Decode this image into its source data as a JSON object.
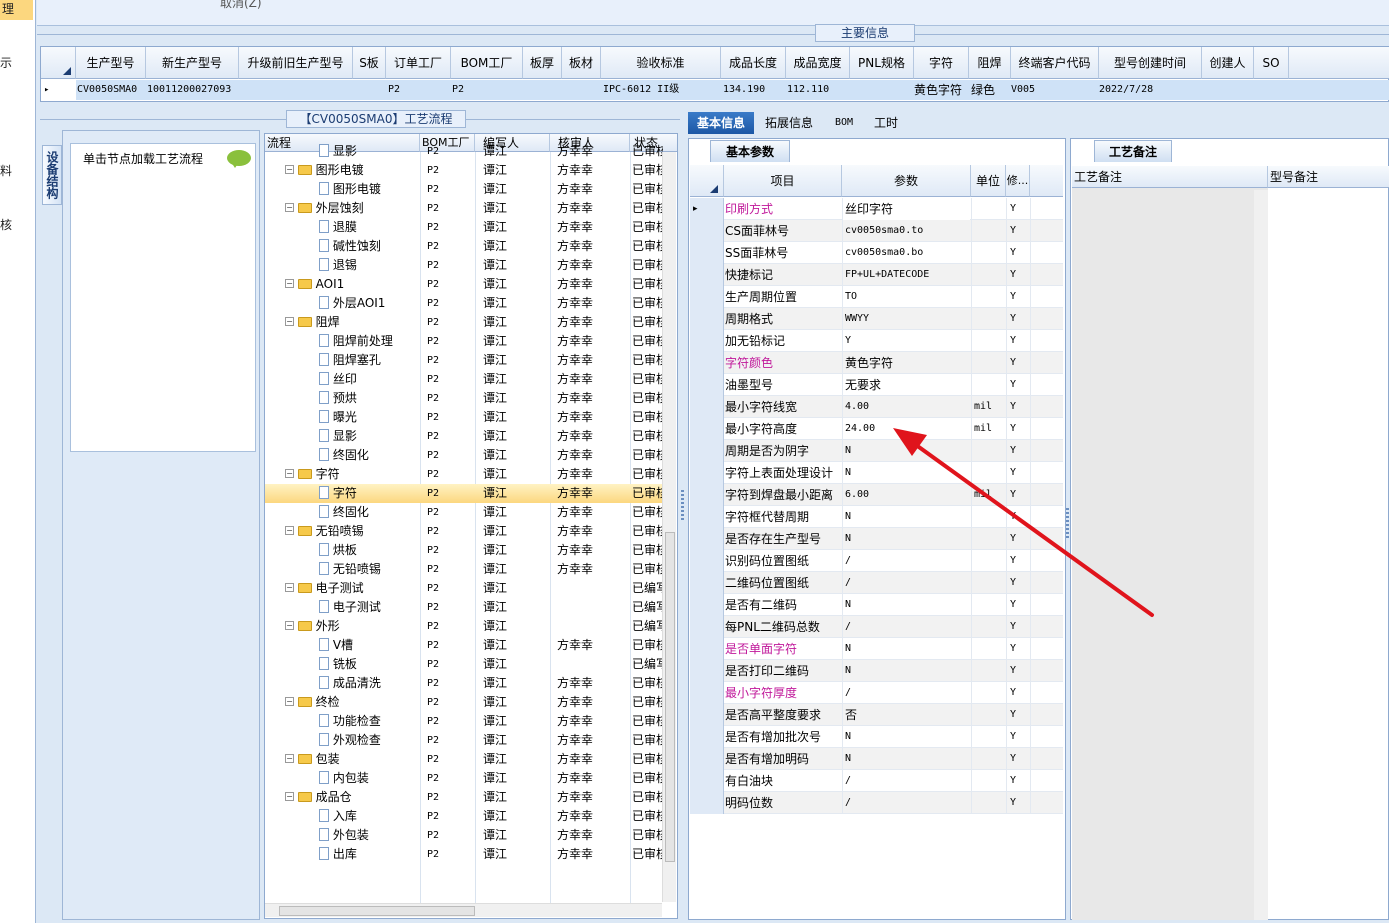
{
  "left_nav": {
    "items": [
      "理",
      "示",
      "料",
      "核"
    ]
  },
  "top": {
    "cut_label": "取消(Z)"
  },
  "main_info": {
    "title": "主要信息",
    "columns": [
      "生产型号",
      "新生产型号",
      "升级前旧生产型号",
      "S板",
      "订单工厂",
      "BOM工厂",
      "板厚",
      "板材",
      "验收标准",
      "成品长度",
      "成品宽度",
      "PNL规格",
      "字符",
      "阻焊",
      "终端客户代码",
      "型号创建时间",
      "创建人",
      "SO"
    ],
    "row": {
      "marker": "▸",
      "production_model": "CV0050SMA0",
      "new_model": "10011200027093",
      "order_factory": "P2",
      "bom_factory": "P2",
      "acceptance": "IPC-6012 II级",
      "length": "134.190",
      "width": "112.110",
      "character": "黄色字符",
      "solder_mask": "绿色",
      "customer_code": "V005",
      "created": "2022/7/28"
    }
  },
  "process_panel": {
    "title": "【CV0050SMA0】工艺流程",
    "vertical_tab": "设备结构",
    "load_hint": "单击节点加载工艺流程",
    "columns": [
      "流程",
      "BOM工厂",
      "编写人",
      "核审人",
      "状态"
    ],
    "rows": [
      {
        "name": "显影",
        "level": 2,
        "type": "doc",
        "bom": "P2",
        "writer": "谭江",
        "reviewer": "方幸幸",
        "status": "已审核"
      },
      {
        "name": "图形电镀",
        "level": 1,
        "type": "folder",
        "bom": "P2",
        "writer": "谭江",
        "reviewer": "方幸幸",
        "status": "已审核"
      },
      {
        "name": "图形电镀",
        "level": 2,
        "type": "doc",
        "bom": "P2",
        "writer": "谭江",
        "reviewer": "方幸幸",
        "status": "已审核"
      },
      {
        "name": "外层蚀刻",
        "level": 1,
        "type": "folder",
        "bom": "P2",
        "writer": "谭江",
        "reviewer": "方幸幸",
        "status": "已审核"
      },
      {
        "name": "退膜",
        "level": 2,
        "type": "doc",
        "bom": "P2",
        "writer": "谭江",
        "reviewer": "方幸幸",
        "status": "已审核"
      },
      {
        "name": "碱性蚀刻",
        "level": 2,
        "type": "doc",
        "bom": "P2",
        "writer": "谭江",
        "reviewer": "方幸幸",
        "status": "已审核"
      },
      {
        "name": "退锡",
        "level": 2,
        "type": "doc",
        "bom": "P2",
        "writer": "谭江",
        "reviewer": "方幸幸",
        "status": "已审核"
      },
      {
        "name": "AOI1",
        "level": 1,
        "type": "folder",
        "bom": "P2",
        "writer": "谭江",
        "reviewer": "方幸幸",
        "status": "已审核"
      },
      {
        "name": "外层AOI1",
        "level": 2,
        "type": "doc",
        "bom": "P2",
        "writer": "谭江",
        "reviewer": "方幸幸",
        "status": "已审核"
      },
      {
        "name": "阻焊",
        "level": 1,
        "type": "folder",
        "bom": "P2",
        "writer": "谭江",
        "reviewer": "方幸幸",
        "status": "已审核"
      },
      {
        "name": "阻焊前处理",
        "level": 2,
        "type": "doc",
        "bom": "P2",
        "writer": "谭江",
        "reviewer": "方幸幸",
        "status": "已审核"
      },
      {
        "name": "阻焊塞孔",
        "level": 2,
        "type": "doc",
        "bom": "P2",
        "writer": "谭江",
        "reviewer": "方幸幸",
        "status": "已审核"
      },
      {
        "name": "丝印",
        "level": 2,
        "type": "doc",
        "bom": "P2",
        "writer": "谭江",
        "reviewer": "方幸幸",
        "status": "已审核"
      },
      {
        "name": "预烘",
        "level": 2,
        "type": "doc",
        "bom": "P2",
        "writer": "谭江",
        "reviewer": "方幸幸",
        "status": "已审核"
      },
      {
        "name": "曝光",
        "level": 2,
        "type": "doc",
        "bom": "P2",
        "writer": "谭江",
        "reviewer": "方幸幸",
        "status": "已审核"
      },
      {
        "name": "显影",
        "level": 2,
        "type": "doc",
        "bom": "P2",
        "writer": "谭江",
        "reviewer": "方幸幸",
        "status": "已审核"
      },
      {
        "name": "终固化",
        "level": 2,
        "type": "doc",
        "bom": "P2",
        "writer": "谭江",
        "reviewer": "方幸幸",
        "status": "已审核"
      },
      {
        "name": "字符",
        "level": 1,
        "type": "folder",
        "bom": "P2",
        "writer": "谭江",
        "reviewer": "方幸幸",
        "status": "已审核"
      },
      {
        "name": "字符",
        "level": 2,
        "type": "doc",
        "bom": "P2",
        "writer": "谭江",
        "reviewer": "方幸幸",
        "status": "已审核",
        "selected": true
      },
      {
        "name": "终固化",
        "level": 2,
        "type": "doc",
        "bom": "P2",
        "writer": "谭江",
        "reviewer": "方幸幸",
        "status": "已审核"
      },
      {
        "name": "无铅喷锡",
        "level": 1,
        "type": "folder",
        "bom": "P2",
        "writer": "谭江",
        "reviewer": "方幸幸",
        "status": "已审核"
      },
      {
        "name": "烘板",
        "level": 2,
        "type": "doc",
        "bom": "P2",
        "writer": "谭江",
        "reviewer": "方幸幸",
        "status": "已审核"
      },
      {
        "name": "无铅喷锡",
        "level": 2,
        "type": "doc",
        "bom": "P2",
        "writer": "谭江",
        "reviewer": "方幸幸",
        "status": "已审核"
      },
      {
        "name": "电子测试",
        "level": 1,
        "type": "folder",
        "bom": "P2",
        "writer": "谭江",
        "reviewer": "",
        "status": "已编写"
      },
      {
        "name": "电子测试",
        "level": 2,
        "type": "doc",
        "bom": "P2",
        "writer": "谭江",
        "reviewer": "",
        "status": "已编写"
      },
      {
        "name": "外形",
        "level": 1,
        "type": "folder",
        "bom": "P2",
        "writer": "谭江",
        "reviewer": "",
        "status": "已编写"
      },
      {
        "name": "V槽",
        "level": 2,
        "type": "doc",
        "bom": "P2",
        "writer": "谭江",
        "reviewer": "方幸幸",
        "status": "已审核"
      },
      {
        "name": "铣板",
        "level": 2,
        "type": "doc",
        "bom": "P2",
        "writer": "谭江",
        "reviewer": "",
        "status": "已编写"
      },
      {
        "name": "成品清洗",
        "level": 2,
        "type": "doc",
        "bom": "P2",
        "writer": "谭江",
        "reviewer": "方幸幸",
        "status": "已审核"
      },
      {
        "name": "终检",
        "level": 1,
        "type": "folder",
        "bom": "P2",
        "writer": "谭江",
        "reviewer": "方幸幸",
        "status": "已审核"
      },
      {
        "name": "功能检查",
        "level": 2,
        "type": "doc",
        "bom": "P2",
        "writer": "谭江",
        "reviewer": "方幸幸",
        "status": "已审核"
      },
      {
        "name": "外观检查",
        "level": 2,
        "type": "doc",
        "bom": "P2",
        "writer": "谭江",
        "reviewer": "方幸幸",
        "status": "已审核"
      },
      {
        "name": "包装",
        "level": 1,
        "type": "folder",
        "bom": "P2",
        "writer": "谭江",
        "reviewer": "方幸幸",
        "status": "已审核"
      },
      {
        "name": "内包装",
        "level": 2,
        "type": "doc",
        "bom": "P2",
        "writer": "谭江",
        "reviewer": "方幸幸",
        "status": "已审核"
      },
      {
        "name": "成品仓",
        "level": 1,
        "type": "folder",
        "bom": "P2",
        "writer": "谭江",
        "reviewer": "方幸幸",
        "status": "已审核"
      },
      {
        "name": "入库",
        "level": 2,
        "type": "doc",
        "bom": "P2",
        "writer": "谭江",
        "reviewer": "方幸幸",
        "status": "已审核"
      },
      {
        "name": "外包装",
        "level": 2,
        "type": "doc",
        "bom": "P2",
        "writer": "谭江",
        "reviewer": "方幸幸",
        "status": "已审核"
      },
      {
        "name": "出库",
        "level": 2,
        "type": "doc",
        "bom": "P2",
        "writer": "谭江",
        "reviewer": "方幸幸",
        "status": "已审核"
      }
    ]
  },
  "right_tabs": [
    "基本信息",
    "拓展信息",
    "BOM",
    "工时"
  ],
  "basic_params": {
    "section_title": "基本参数",
    "columns": [
      "项目",
      "参数",
      "单位",
      "修..."
    ],
    "rows": [
      {
        "item": "印刷方式",
        "value": "丝印字符",
        "unit": "",
        "mod": "Y",
        "highlight": true,
        "current": true
      },
      {
        "item": "CS面菲林号",
        "value": "cv0050sma0.to",
        "unit": "",
        "mod": "Y"
      },
      {
        "item": "SS面菲林号",
        "value": "cv0050sma0.bo",
        "unit": "",
        "mod": "Y"
      },
      {
        "item": "快捷标记",
        "value": "FP+UL+DATECODE",
        "unit": "",
        "mod": "Y"
      },
      {
        "item": "生产周期位置",
        "value": "TO",
        "unit": "",
        "mod": "Y"
      },
      {
        "item": "周期格式",
        "value": "WWYY",
        "unit": "",
        "mod": "Y"
      },
      {
        "item": "加无铅标记",
        "value": "Y",
        "unit": "",
        "mod": "Y"
      },
      {
        "item": "字符颜色",
        "value": "黄色字符",
        "unit": "",
        "mod": "Y",
        "highlight": true
      },
      {
        "item": "油墨型号",
        "value": "无要求",
        "unit": "",
        "mod": "Y"
      },
      {
        "item": "最小字符线宽",
        "value": "4.00",
        "unit": "mil",
        "mod": "Y"
      },
      {
        "item": "最小字符高度",
        "value": "24.00",
        "unit": "mil",
        "mod": "Y"
      },
      {
        "item": "周期是否为阴字",
        "value": "N",
        "unit": "",
        "mod": "Y"
      },
      {
        "item": "字符上表面处理设计",
        "value": "N",
        "unit": "",
        "mod": "Y"
      },
      {
        "item": "字符到焊盘最小距离",
        "value": "6.00",
        "unit": "mil",
        "mod": "Y"
      },
      {
        "item": "字符框代替周期",
        "value": "N",
        "unit": "",
        "mod": "Y"
      },
      {
        "item": "是否存在生产型号",
        "value": "N",
        "unit": "",
        "mod": "Y"
      },
      {
        "item": "识别码位置图纸",
        "value": "/",
        "unit": "",
        "mod": "Y"
      },
      {
        "item": "二维码位置图纸",
        "value": "/",
        "unit": "",
        "mod": "Y"
      },
      {
        "item": "是否有二维码",
        "value": "N",
        "unit": "",
        "mod": "Y"
      },
      {
        "item": "每PNL二维码总数",
        "value": "/",
        "unit": "",
        "mod": "Y"
      },
      {
        "item": "是否单面字符",
        "value": "N",
        "unit": "",
        "mod": "Y",
        "highlight": true
      },
      {
        "item": "是否打印二维码",
        "value": "N",
        "unit": "",
        "mod": "Y"
      },
      {
        "item": "最小字符厚度",
        "value": "/",
        "unit": "",
        "mod": "Y",
        "highlight": true
      },
      {
        "item": "是否高平整度要求",
        "value": "否",
        "unit": "",
        "mod": "Y"
      },
      {
        "item": "是否有增加批次号",
        "value": "N",
        "unit": "",
        "mod": "Y"
      },
      {
        "item": "是否有增加明码",
        "value": "N",
        "unit": "",
        "mod": "Y"
      },
      {
        "item": "有白油块",
        "value": "/",
        "unit": "",
        "mod": "Y"
      },
      {
        "item": "明码位数",
        "value": "/",
        "unit": "",
        "mod": "Y"
      }
    ]
  },
  "process_notes": {
    "section_title": "工艺备注",
    "columns": [
      "工艺备注",
      "型号备注"
    ]
  },
  "colors": {
    "highlight_text": "#c0179a",
    "arrow": "#e0141c",
    "tab_active": "#1c57a5",
    "selected_row": "#fcd77f"
  }
}
